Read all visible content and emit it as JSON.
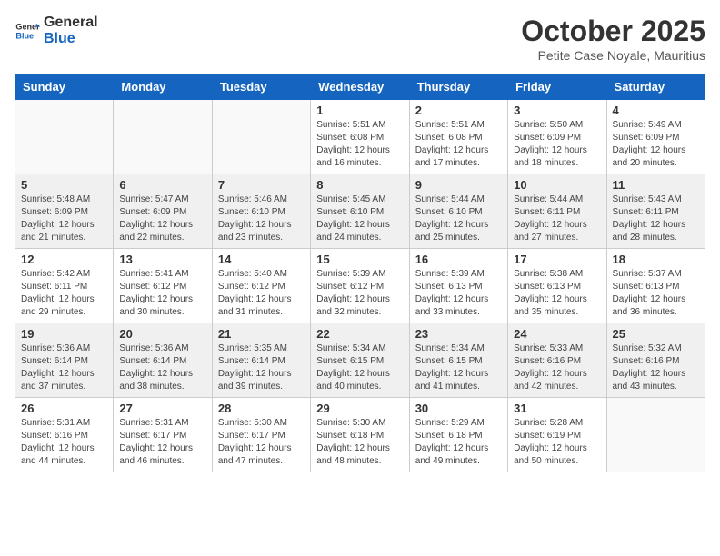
{
  "header": {
    "logo_general": "General",
    "logo_blue": "Blue",
    "month": "October 2025",
    "location": "Petite Case Noyale, Mauritius"
  },
  "days_of_week": [
    "Sunday",
    "Monday",
    "Tuesday",
    "Wednesday",
    "Thursday",
    "Friday",
    "Saturday"
  ],
  "weeks": [
    [
      {
        "day": "",
        "sunrise": "",
        "sunset": "",
        "daylight": "",
        "empty": true
      },
      {
        "day": "",
        "sunrise": "",
        "sunset": "",
        "daylight": "",
        "empty": true
      },
      {
        "day": "",
        "sunrise": "",
        "sunset": "",
        "daylight": "",
        "empty": true
      },
      {
        "day": "1",
        "sunrise": "Sunrise: 5:51 AM",
        "sunset": "Sunset: 6:08 PM",
        "daylight": "Daylight: 12 hours and 16 minutes.",
        "empty": false
      },
      {
        "day": "2",
        "sunrise": "Sunrise: 5:51 AM",
        "sunset": "Sunset: 6:08 PM",
        "daylight": "Daylight: 12 hours and 17 minutes.",
        "empty": false
      },
      {
        "day": "3",
        "sunrise": "Sunrise: 5:50 AM",
        "sunset": "Sunset: 6:09 PM",
        "daylight": "Daylight: 12 hours and 18 minutes.",
        "empty": false
      },
      {
        "day": "4",
        "sunrise": "Sunrise: 5:49 AM",
        "sunset": "Sunset: 6:09 PM",
        "daylight": "Daylight: 12 hours and 20 minutes.",
        "empty": false
      }
    ],
    [
      {
        "day": "5",
        "sunrise": "Sunrise: 5:48 AM",
        "sunset": "Sunset: 6:09 PM",
        "daylight": "Daylight: 12 hours and 21 minutes.",
        "empty": false
      },
      {
        "day": "6",
        "sunrise": "Sunrise: 5:47 AM",
        "sunset": "Sunset: 6:09 PM",
        "daylight": "Daylight: 12 hours and 22 minutes.",
        "empty": false
      },
      {
        "day": "7",
        "sunrise": "Sunrise: 5:46 AM",
        "sunset": "Sunset: 6:10 PM",
        "daylight": "Daylight: 12 hours and 23 minutes.",
        "empty": false
      },
      {
        "day": "8",
        "sunrise": "Sunrise: 5:45 AM",
        "sunset": "Sunset: 6:10 PM",
        "daylight": "Daylight: 12 hours and 24 minutes.",
        "empty": false
      },
      {
        "day": "9",
        "sunrise": "Sunrise: 5:44 AM",
        "sunset": "Sunset: 6:10 PM",
        "daylight": "Daylight: 12 hours and 25 minutes.",
        "empty": false
      },
      {
        "day": "10",
        "sunrise": "Sunrise: 5:44 AM",
        "sunset": "Sunset: 6:11 PM",
        "daylight": "Daylight: 12 hours and 27 minutes.",
        "empty": false
      },
      {
        "day": "11",
        "sunrise": "Sunrise: 5:43 AM",
        "sunset": "Sunset: 6:11 PM",
        "daylight": "Daylight: 12 hours and 28 minutes.",
        "empty": false
      }
    ],
    [
      {
        "day": "12",
        "sunrise": "Sunrise: 5:42 AM",
        "sunset": "Sunset: 6:11 PM",
        "daylight": "Daylight: 12 hours and 29 minutes.",
        "empty": false
      },
      {
        "day": "13",
        "sunrise": "Sunrise: 5:41 AM",
        "sunset": "Sunset: 6:12 PM",
        "daylight": "Daylight: 12 hours and 30 minutes.",
        "empty": false
      },
      {
        "day": "14",
        "sunrise": "Sunrise: 5:40 AM",
        "sunset": "Sunset: 6:12 PM",
        "daylight": "Daylight: 12 hours and 31 minutes.",
        "empty": false
      },
      {
        "day": "15",
        "sunrise": "Sunrise: 5:39 AM",
        "sunset": "Sunset: 6:12 PM",
        "daylight": "Daylight: 12 hours and 32 minutes.",
        "empty": false
      },
      {
        "day": "16",
        "sunrise": "Sunrise: 5:39 AM",
        "sunset": "Sunset: 6:13 PM",
        "daylight": "Daylight: 12 hours and 33 minutes.",
        "empty": false
      },
      {
        "day": "17",
        "sunrise": "Sunrise: 5:38 AM",
        "sunset": "Sunset: 6:13 PM",
        "daylight": "Daylight: 12 hours and 35 minutes.",
        "empty": false
      },
      {
        "day": "18",
        "sunrise": "Sunrise: 5:37 AM",
        "sunset": "Sunset: 6:13 PM",
        "daylight": "Daylight: 12 hours and 36 minutes.",
        "empty": false
      }
    ],
    [
      {
        "day": "19",
        "sunrise": "Sunrise: 5:36 AM",
        "sunset": "Sunset: 6:14 PM",
        "daylight": "Daylight: 12 hours and 37 minutes.",
        "empty": false
      },
      {
        "day": "20",
        "sunrise": "Sunrise: 5:36 AM",
        "sunset": "Sunset: 6:14 PM",
        "daylight": "Daylight: 12 hours and 38 minutes.",
        "empty": false
      },
      {
        "day": "21",
        "sunrise": "Sunrise: 5:35 AM",
        "sunset": "Sunset: 6:14 PM",
        "daylight": "Daylight: 12 hours and 39 minutes.",
        "empty": false
      },
      {
        "day": "22",
        "sunrise": "Sunrise: 5:34 AM",
        "sunset": "Sunset: 6:15 PM",
        "daylight": "Daylight: 12 hours and 40 minutes.",
        "empty": false
      },
      {
        "day": "23",
        "sunrise": "Sunrise: 5:34 AM",
        "sunset": "Sunset: 6:15 PM",
        "daylight": "Daylight: 12 hours and 41 minutes.",
        "empty": false
      },
      {
        "day": "24",
        "sunrise": "Sunrise: 5:33 AM",
        "sunset": "Sunset: 6:16 PM",
        "daylight": "Daylight: 12 hours and 42 minutes.",
        "empty": false
      },
      {
        "day": "25",
        "sunrise": "Sunrise: 5:32 AM",
        "sunset": "Sunset: 6:16 PM",
        "daylight": "Daylight: 12 hours and 43 minutes.",
        "empty": false
      }
    ],
    [
      {
        "day": "26",
        "sunrise": "Sunrise: 5:31 AM",
        "sunset": "Sunset: 6:16 PM",
        "daylight": "Daylight: 12 hours and 44 minutes.",
        "empty": false
      },
      {
        "day": "27",
        "sunrise": "Sunrise: 5:31 AM",
        "sunset": "Sunset: 6:17 PM",
        "daylight": "Daylight: 12 hours and 46 minutes.",
        "empty": false
      },
      {
        "day": "28",
        "sunrise": "Sunrise: 5:30 AM",
        "sunset": "Sunset: 6:17 PM",
        "daylight": "Daylight: 12 hours and 47 minutes.",
        "empty": false
      },
      {
        "day": "29",
        "sunrise": "Sunrise: 5:30 AM",
        "sunset": "Sunset: 6:18 PM",
        "daylight": "Daylight: 12 hours and 48 minutes.",
        "empty": false
      },
      {
        "day": "30",
        "sunrise": "Sunrise: 5:29 AM",
        "sunset": "Sunset: 6:18 PM",
        "daylight": "Daylight: 12 hours and 49 minutes.",
        "empty": false
      },
      {
        "day": "31",
        "sunrise": "Sunrise: 5:28 AM",
        "sunset": "Sunset: 6:19 PM",
        "daylight": "Daylight: 12 hours and 50 minutes.",
        "empty": false
      },
      {
        "day": "",
        "sunrise": "",
        "sunset": "",
        "daylight": "",
        "empty": true
      }
    ]
  ]
}
